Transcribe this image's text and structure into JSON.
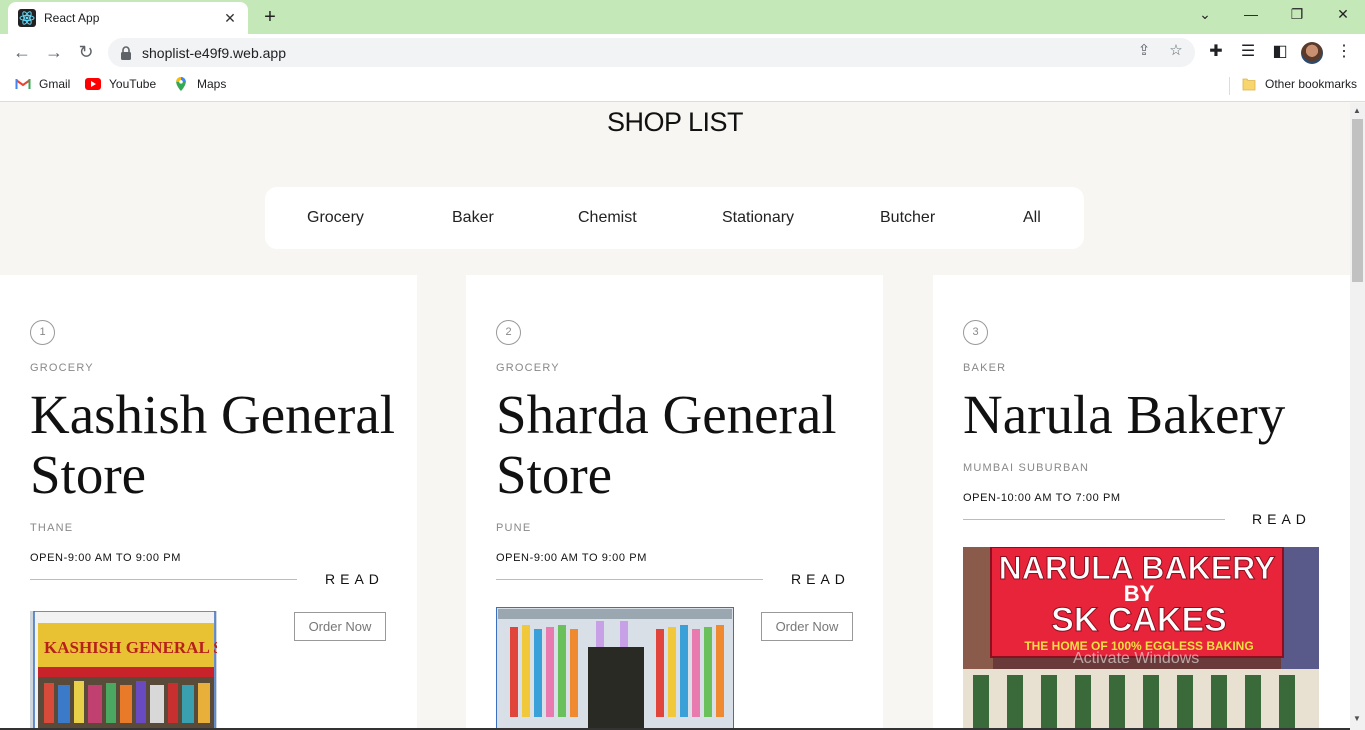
{
  "browser": {
    "tab_title": "React App",
    "url": "shoplist-e49f9.web.app",
    "bookmarks": [
      {
        "label": "Gmail",
        "icon": "gmail-icon"
      },
      {
        "label": "YouTube",
        "icon": "youtube-icon"
      },
      {
        "label": "Maps",
        "icon": "maps-icon"
      }
    ],
    "other_bookmarks": "Other bookmarks"
  },
  "page": {
    "title": "SHOP LIST",
    "filters": [
      "Grocery",
      "Baker",
      "Chemist",
      "Stationary",
      "Butcher",
      "All"
    ]
  },
  "cards": [
    {
      "number": "1",
      "category": "GROCERY",
      "name": "Kashish General Store",
      "location": "THANE",
      "hours": "OPEN-9:00 AM TO 9:00 PM",
      "read_label": "READ",
      "order_label": "Order Now",
      "photo_sign": "KASHISH GENERAL STORE"
    },
    {
      "number": "2",
      "category": "GROCERY",
      "name": "Sharda General Store",
      "location": "PUNE",
      "hours": "OPEN-9:00 AM TO 9:00 PM",
      "read_label": "READ",
      "order_label": "Order Now"
    },
    {
      "number": "3",
      "category": "BAKER",
      "name": "Narula Bakery",
      "location": "MUMBAI SUBURBAN",
      "hours": "OPEN-10:00 AM TO 7:00 PM",
      "read_label": "READ",
      "photo_sign_1": "NARULA BAKERY",
      "photo_sign_2": "BY",
      "photo_sign_3": "SK CAKES",
      "photo_sign_4": "THE HOME OF 100% EGGLESS BAKING"
    }
  ],
  "overlay": {
    "watermark": "Activate Windows"
  },
  "colors": {
    "tabbar": "#c5e8b9",
    "page_bg": "#f8f6f2",
    "card_bg": "#ffffff"
  }
}
